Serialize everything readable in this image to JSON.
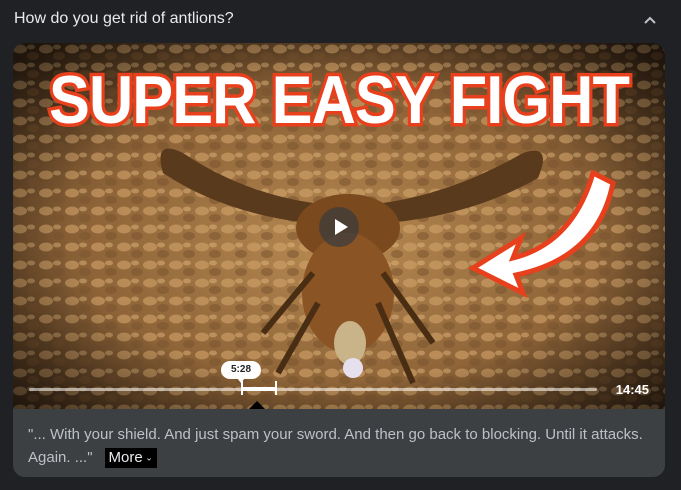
{
  "question": "How do you get rid of antlions?",
  "video": {
    "thumbnail_title": "SUPER EASY FIGHT",
    "timestamp": "5:28",
    "duration": "14:45",
    "clip_start_fraction": 0.375,
    "clip_end_fraction": 0.435
  },
  "caption": {
    "text": "\"... With your shield. And just spam your sword. And then go back to blocking. Until it attacks. Again. ...\"",
    "more_label": "More"
  },
  "colors": {
    "background": "#202124",
    "card": "#3c4043",
    "title_fill": "#ffffff",
    "title_outline": "#e8401c",
    "arrow": "#ffffff"
  },
  "icons": [
    "chevron-up-icon",
    "play-icon",
    "chevron-down-icon"
  ]
}
